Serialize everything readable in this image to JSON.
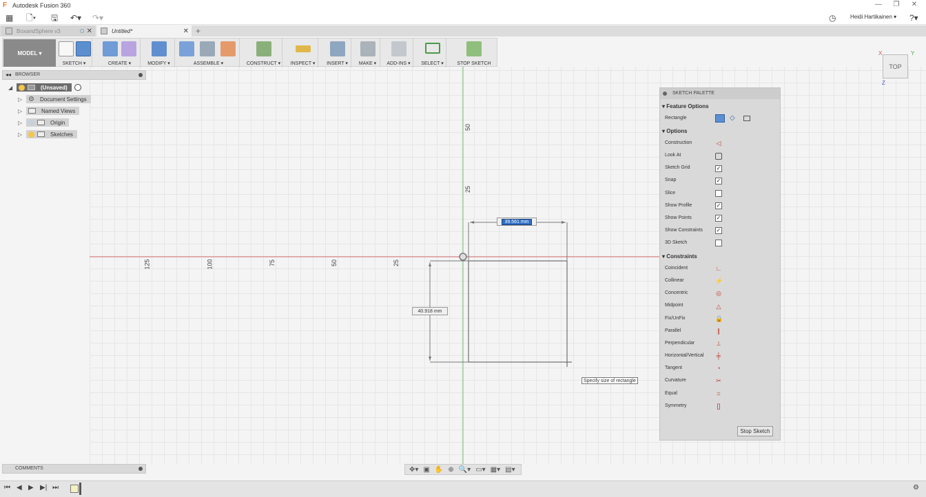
{
  "window": {
    "title": "Autodesk Fusion 360",
    "user": "Heidi Hartikainen ▾"
  },
  "tabs": [
    {
      "label": "BoxandSphere v3",
      "active": false
    },
    {
      "label": "Untitled*",
      "active": true
    }
  ],
  "toolbar": {
    "workspace": "MODEL ▾",
    "groups": {
      "sketch": "SKETCH ▾",
      "create": "CREATE ▾",
      "modify": "MODIFY ▾",
      "assemble": "ASSEMBLE ▾",
      "construct": "CONSTRUCT ▾",
      "inspect": "INSPECT ▾",
      "insert": "INSERT ▾",
      "make": "MAKE ▾",
      "addins": "ADD-INS ▾",
      "select": "SELECT ▾",
      "stop_sketch": "STOP SKETCH"
    }
  },
  "browser": {
    "title": "BROWSER",
    "root": "(Unsaved)",
    "items": [
      "Document Settings",
      "Named Views",
      "Origin",
      "Sketches"
    ]
  },
  "comments": {
    "title": "COMMENTS"
  },
  "viewcube": {
    "face": "TOP",
    "x": "X",
    "y": "Y",
    "z": "Z"
  },
  "axis_labels": {
    "v50": "50",
    "v25": "25",
    "h125": "125",
    "h100": "100",
    "h75": "75",
    "h50": "50",
    "h25": "25"
  },
  "dimensions": {
    "width": "39.561 mm",
    "height": "40.918 mm"
  },
  "tooltip": "Specify size of rectangle",
  "palette": {
    "title": "SKETCH PALETTE",
    "feature_options": "Feature Options",
    "rectangle": "Rectangle",
    "options_title": "Options",
    "options": {
      "construction": "Construction",
      "look_at": "Look At",
      "sketch_grid": "Sketch Grid",
      "snap": "Snap",
      "slice": "Slice",
      "show_profile": "Show Profile",
      "show_points": "Show Points",
      "show_constraints": "Show Constraints",
      "sketch3d": "3D Sketch"
    },
    "checkbox_states": {
      "sketch_grid": true,
      "snap": true,
      "slice": false,
      "show_profile": true,
      "show_points": true,
      "show_constraints": true,
      "sketch3d": false
    },
    "constraints_title": "Constraints",
    "constraints": {
      "coincident": "Coincident",
      "collinear": "Collinear",
      "concentric": "Concentric",
      "midpoint": "Midpoint",
      "fixunfix": "Fix/UnFix",
      "parallel": "Parallel",
      "perpendicular": "Perpendicular",
      "horizontal_vertical": "Horizontal/Vertical",
      "tangent": "Tangent",
      "curvature": "Curvature",
      "equal": "Equal",
      "symmetry": "Symmetry"
    },
    "stop_button": "Stop Sketch"
  },
  "colors": {
    "accent": "#5b8fd0",
    "constraint": "#c0392b",
    "x_axis": "#d36b6b",
    "y_axis": "#6fbf6f"
  }
}
